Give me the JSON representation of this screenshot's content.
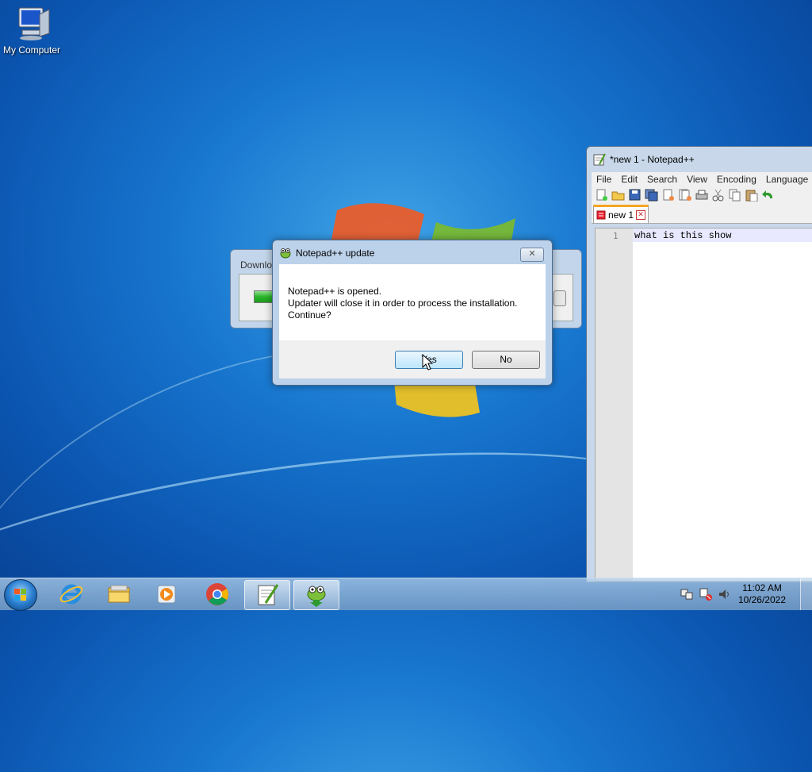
{
  "desktop": {
    "icons": [
      {
        "label": "My Computer",
        "icon": "my-computer-icon"
      }
    ]
  },
  "download_window": {
    "title": "Downlo"
  },
  "dialog": {
    "title": "Notepad++ update",
    "close_label": "✕",
    "message_line1": "Notepad++ is opened.",
    "message_line2": "Updater will close it in order to process the installation.",
    "message_line3": "Continue?",
    "yes_label": "Yes",
    "no_label": "No"
  },
  "notepad": {
    "title": "*new 1 - Notepad++",
    "menu": [
      "File",
      "Edit",
      "Search",
      "View",
      "Encoding",
      "Language"
    ],
    "tab_label": "new 1",
    "line_number": "1",
    "line_text": "what is this show"
  },
  "taskbar": {
    "items": [
      "internet-explorer-icon",
      "file-explorer-icon",
      "media-player-icon",
      "chrome-icon",
      "notepad-plus-plus-icon",
      "notepad-updater-icon"
    ],
    "time": "11:02 AM",
    "date": "10/26/2022"
  },
  "colors": {
    "accent": "#1877cf",
    "taskbar": "#a9c8e6"
  }
}
